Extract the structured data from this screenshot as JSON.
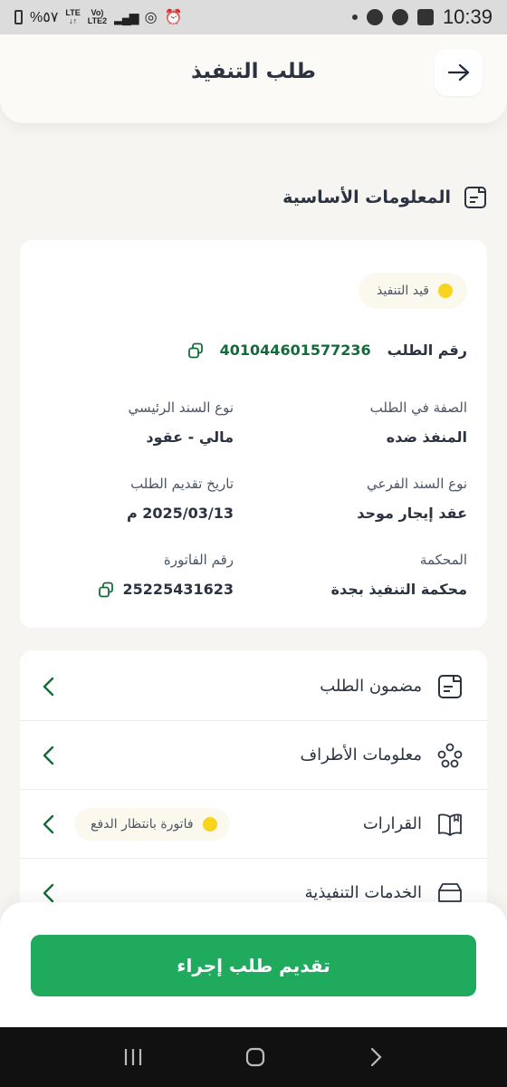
{
  "status_bar": {
    "left_text": "%٥٧",
    "net1": "LTE",
    "net2a": "Vo)",
    "net2b": "LTE2",
    "time": "10:39"
  },
  "header": {
    "title": "طلب التنفيذ"
  },
  "section": {
    "title": "المعلومات الأساسية"
  },
  "info": {
    "status": "قيد التنفيذ",
    "request_number_label": "رقم الطلب",
    "request_number": "401044601577236",
    "fields": {
      "role_label": "الصفة في الطلب",
      "role_value": "المنفذ ضده",
      "main_bond_type_label": "نوع السند الرئيسي",
      "main_bond_type_value": "مالي - عقود",
      "sub_bond_type_label": "نوع السند الفرعي",
      "sub_bond_type_value": "عقد إيجار موحد",
      "submit_date_label": "تاريخ تقديم الطلب",
      "submit_date_value": "2025/03/13 م",
      "court_label": "المحكمة",
      "court_value": "محكمة التنفيذ بجدة",
      "invoice_label": "رقم الفاتورة",
      "invoice_value": "25225431623"
    }
  },
  "menu": {
    "items": [
      {
        "label": "مضمون الطلب",
        "icon": "document-icon"
      },
      {
        "label": "معلومات الأطراف",
        "icon": "people-icon"
      },
      {
        "label": "القرارات",
        "icon": "book-icon",
        "badge": "فاتورة بانتظار الدفع"
      },
      {
        "label": "الخدمات التنفيذية",
        "icon": "folder-icon"
      }
    ]
  },
  "cta": {
    "label": "تقديم طلب إجراء"
  },
  "colors": {
    "primary_green": "#1faa5e",
    "dark_green": "#146b3a",
    "status_yellow": "#f7d41e"
  }
}
